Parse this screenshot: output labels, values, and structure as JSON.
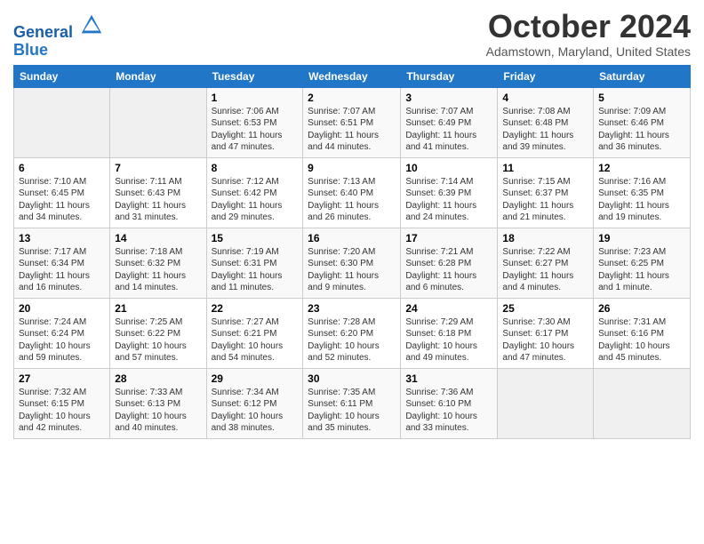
{
  "header": {
    "logo_line1": "General",
    "logo_line2": "Blue",
    "month_title": "October 2024",
    "location": "Adamstown, Maryland, United States"
  },
  "weekdays": [
    "Sunday",
    "Monday",
    "Tuesday",
    "Wednesday",
    "Thursday",
    "Friday",
    "Saturday"
  ],
  "weeks": [
    [
      {
        "day": "",
        "sunrise": "",
        "sunset": "",
        "daylight": ""
      },
      {
        "day": "",
        "sunrise": "",
        "sunset": "",
        "daylight": ""
      },
      {
        "day": "1",
        "sunrise": "Sunrise: 7:06 AM",
        "sunset": "Sunset: 6:53 PM",
        "daylight": "Daylight: 11 hours and 47 minutes."
      },
      {
        "day": "2",
        "sunrise": "Sunrise: 7:07 AM",
        "sunset": "Sunset: 6:51 PM",
        "daylight": "Daylight: 11 hours and 44 minutes."
      },
      {
        "day": "3",
        "sunrise": "Sunrise: 7:07 AM",
        "sunset": "Sunset: 6:49 PM",
        "daylight": "Daylight: 11 hours and 41 minutes."
      },
      {
        "day": "4",
        "sunrise": "Sunrise: 7:08 AM",
        "sunset": "Sunset: 6:48 PM",
        "daylight": "Daylight: 11 hours and 39 minutes."
      },
      {
        "day": "5",
        "sunrise": "Sunrise: 7:09 AM",
        "sunset": "Sunset: 6:46 PM",
        "daylight": "Daylight: 11 hours and 36 minutes."
      }
    ],
    [
      {
        "day": "6",
        "sunrise": "Sunrise: 7:10 AM",
        "sunset": "Sunset: 6:45 PM",
        "daylight": "Daylight: 11 hours and 34 minutes."
      },
      {
        "day": "7",
        "sunrise": "Sunrise: 7:11 AM",
        "sunset": "Sunset: 6:43 PM",
        "daylight": "Daylight: 11 hours and 31 minutes."
      },
      {
        "day": "8",
        "sunrise": "Sunrise: 7:12 AM",
        "sunset": "Sunset: 6:42 PM",
        "daylight": "Daylight: 11 hours and 29 minutes."
      },
      {
        "day": "9",
        "sunrise": "Sunrise: 7:13 AM",
        "sunset": "Sunset: 6:40 PM",
        "daylight": "Daylight: 11 hours and 26 minutes."
      },
      {
        "day": "10",
        "sunrise": "Sunrise: 7:14 AM",
        "sunset": "Sunset: 6:39 PM",
        "daylight": "Daylight: 11 hours and 24 minutes."
      },
      {
        "day": "11",
        "sunrise": "Sunrise: 7:15 AM",
        "sunset": "Sunset: 6:37 PM",
        "daylight": "Daylight: 11 hours and 21 minutes."
      },
      {
        "day": "12",
        "sunrise": "Sunrise: 7:16 AM",
        "sunset": "Sunset: 6:35 PM",
        "daylight": "Daylight: 11 hours and 19 minutes."
      }
    ],
    [
      {
        "day": "13",
        "sunrise": "Sunrise: 7:17 AM",
        "sunset": "Sunset: 6:34 PM",
        "daylight": "Daylight: 11 hours and 16 minutes."
      },
      {
        "day": "14",
        "sunrise": "Sunrise: 7:18 AM",
        "sunset": "Sunset: 6:32 PM",
        "daylight": "Daylight: 11 hours and 14 minutes."
      },
      {
        "day": "15",
        "sunrise": "Sunrise: 7:19 AM",
        "sunset": "Sunset: 6:31 PM",
        "daylight": "Daylight: 11 hours and 11 minutes."
      },
      {
        "day": "16",
        "sunrise": "Sunrise: 7:20 AM",
        "sunset": "Sunset: 6:30 PM",
        "daylight": "Daylight: 11 hours and 9 minutes."
      },
      {
        "day": "17",
        "sunrise": "Sunrise: 7:21 AM",
        "sunset": "Sunset: 6:28 PM",
        "daylight": "Daylight: 11 hours and 6 minutes."
      },
      {
        "day": "18",
        "sunrise": "Sunrise: 7:22 AM",
        "sunset": "Sunset: 6:27 PM",
        "daylight": "Daylight: 11 hours and 4 minutes."
      },
      {
        "day": "19",
        "sunrise": "Sunrise: 7:23 AM",
        "sunset": "Sunset: 6:25 PM",
        "daylight": "Daylight: 11 hours and 1 minute."
      }
    ],
    [
      {
        "day": "20",
        "sunrise": "Sunrise: 7:24 AM",
        "sunset": "Sunset: 6:24 PM",
        "daylight": "Daylight: 10 hours and 59 minutes."
      },
      {
        "day": "21",
        "sunrise": "Sunrise: 7:25 AM",
        "sunset": "Sunset: 6:22 PM",
        "daylight": "Daylight: 10 hours and 57 minutes."
      },
      {
        "day": "22",
        "sunrise": "Sunrise: 7:27 AM",
        "sunset": "Sunset: 6:21 PM",
        "daylight": "Daylight: 10 hours and 54 minutes."
      },
      {
        "day": "23",
        "sunrise": "Sunrise: 7:28 AM",
        "sunset": "Sunset: 6:20 PM",
        "daylight": "Daylight: 10 hours and 52 minutes."
      },
      {
        "day": "24",
        "sunrise": "Sunrise: 7:29 AM",
        "sunset": "Sunset: 6:18 PM",
        "daylight": "Daylight: 10 hours and 49 minutes."
      },
      {
        "day": "25",
        "sunrise": "Sunrise: 7:30 AM",
        "sunset": "Sunset: 6:17 PM",
        "daylight": "Daylight: 10 hours and 47 minutes."
      },
      {
        "day": "26",
        "sunrise": "Sunrise: 7:31 AM",
        "sunset": "Sunset: 6:16 PM",
        "daylight": "Daylight: 10 hours and 45 minutes."
      }
    ],
    [
      {
        "day": "27",
        "sunrise": "Sunrise: 7:32 AM",
        "sunset": "Sunset: 6:15 PM",
        "daylight": "Daylight: 10 hours and 42 minutes."
      },
      {
        "day": "28",
        "sunrise": "Sunrise: 7:33 AM",
        "sunset": "Sunset: 6:13 PM",
        "daylight": "Daylight: 10 hours and 40 minutes."
      },
      {
        "day": "29",
        "sunrise": "Sunrise: 7:34 AM",
        "sunset": "Sunset: 6:12 PM",
        "daylight": "Daylight: 10 hours and 38 minutes."
      },
      {
        "day": "30",
        "sunrise": "Sunrise: 7:35 AM",
        "sunset": "Sunset: 6:11 PM",
        "daylight": "Daylight: 10 hours and 35 minutes."
      },
      {
        "day": "31",
        "sunrise": "Sunrise: 7:36 AM",
        "sunset": "Sunset: 6:10 PM",
        "daylight": "Daylight: 10 hours and 33 minutes."
      },
      {
        "day": "",
        "sunrise": "",
        "sunset": "",
        "daylight": ""
      },
      {
        "day": "",
        "sunrise": "",
        "sunset": "",
        "daylight": ""
      }
    ]
  ]
}
